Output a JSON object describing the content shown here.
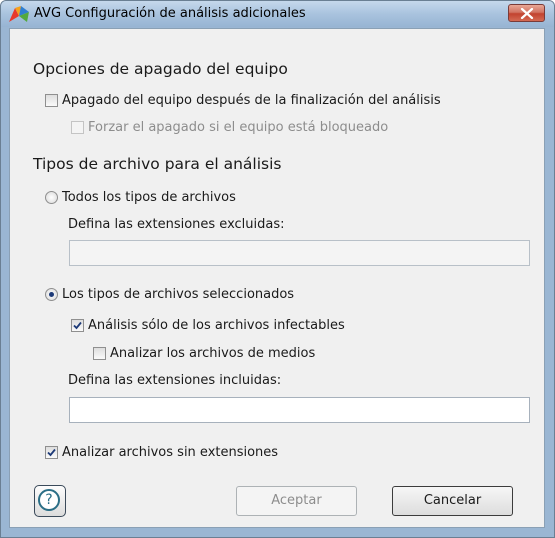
{
  "window": {
    "title": "AVG Configuración de análisis adicionales"
  },
  "shutdown": {
    "heading": "Opciones de apagado del equipo",
    "shutdown_after_scan": {
      "label": "Apagado del equipo después de la finalización del análisis",
      "checked": false
    },
    "force_if_locked": {
      "label": "Forzar el apagado si el equipo está bloqueado",
      "checked": false,
      "enabled": false
    }
  },
  "file_types": {
    "heading": "Tipos de archivo para el análisis",
    "all_types": {
      "label": "Todos los tipos de archivos",
      "selected": false
    },
    "excluded_label": "Defina las extensiones excluidas:",
    "excluded_value": "",
    "selected_types": {
      "label": "Los tipos de archivos seleccionados",
      "selected": true
    },
    "infectable_only": {
      "label": "Análisis sólo de los archivos infectables",
      "checked": true
    },
    "scan_media": {
      "label": "Analizar los archivos de medios",
      "checked": false
    },
    "included_label": "Defina las extensiones incluidas:",
    "included_value": "",
    "no_extensions": {
      "label": "Analizar archivos sin extensiones",
      "checked": true
    }
  },
  "buttons": {
    "help_glyph": "?",
    "accept_label": "Aceptar",
    "cancel_label": "Cancelar"
  },
  "icons": {
    "app": "avg-logo-icon",
    "close": "close-icon",
    "help": "help-icon",
    "check": "checkmark-icon"
  },
  "colors": {
    "title_bar": "#a9c3de",
    "close_button": "#c2432f",
    "dialog_background": "#f0f0f0",
    "help_icon": "#2a6e86"
  }
}
